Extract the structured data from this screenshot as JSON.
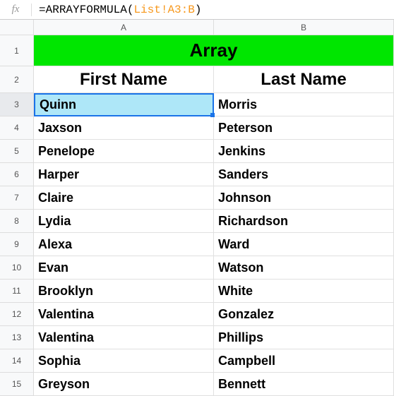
{
  "formula_bar": {
    "eq": "=",
    "fn_open": "ARRAYFORMULA(",
    "ref": "List!A3:B",
    "fn_close": ")"
  },
  "columns": {
    "a": "A",
    "b": "B"
  },
  "rows": [
    "1",
    "2",
    "3",
    "4",
    "5",
    "6",
    "7",
    "8",
    "9",
    "10",
    "11",
    "12",
    "13",
    "14",
    "15"
  ],
  "merged_title": "Array",
  "headers": {
    "first": "First Name",
    "last": "Last Name"
  },
  "data": [
    {
      "first": "Quinn",
      "last": "Morris"
    },
    {
      "first": "Jaxson",
      "last": "Peterson"
    },
    {
      "first": "Penelope",
      "last": "Jenkins"
    },
    {
      "first": "Harper",
      "last": "Sanders"
    },
    {
      "first": "Claire",
      "last": "Johnson"
    },
    {
      "first": "Lydia",
      "last": "Richardson"
    },
    {
      "first": "Alexa",
      "last": "Ward"
    },
    {
      "first": "Evan",
      "last": "Watson"
    },
    {
      "first": "Brooklyn",
      "last": "White"
    },
    {
      "first": "Valentina",
      "last": "Gonzalez"
    },
    {
      "first": "Valentina",
      "last": "Phillips"
    },
    {
      "first": "Sophia",
      "last": "Campbell"
    },
    {
      "first": "Greyson",
      "last": "Bennett"
    }
  ],
  "chart_data": {
    "type": "table",
    "title": "Array",
    "columns": [
      "First Name",
      "Last Name"
    ],
    "rows": [
      [
        "Quinn",
        "Morris"
      ],
      [
        "Jaxson",
        "Peterson"
      ],
      [
        "Penelope",
        "Jenkins"
      ],
      [
        "Harper",
        "Sanders"
      ],
      [
        "Claire",
        "Johnson"
      ],
      [
        "Lydia",
        "Richardson"
      ],
      [
        "Alexa",
        "Ward"
      ],
      [
        "Evan",
        "Watson"
      ],
      [
        "Brooklyn",
        "White"
      ],
      [
        "Valentina",
        "Gonzalez"
      ],
      [
        "Valentina",
        "Phillips"
      ],
      [
        "Sophia",
        "Campbell"
      ],
      [
        "Greyson",
        "Bennett"
      ]
    ]
  }
}
